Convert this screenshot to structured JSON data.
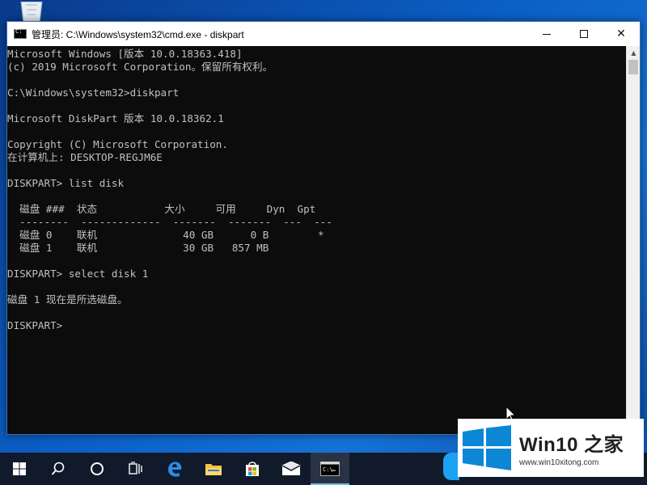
{
  "window": {
    "title": "管理员: C:\\Windows\\system32\\cmd.exe - diskpart",
    "minimize_icon": "minimize-icon",
    "maximize_icon": "maximize-icon",
    "close_label": "✕"
  },
  "console": {
    "lines": [
      "Microsoft Windows [版本 10.0.18363.418]",
      "(c) 2019 Microsoft Corporation。保留所有权利。",
      "",
      "C:\\Windows\\system32>diskpart",
      "",
      "Microsoft DiskPart 版本 10.0.18362.1",
      "",
      "Copyright (C) Microsoft Corporation.",
      "在计算机上: DESKTOP-REGJM6E",
      "",
      "DISKPART> list disk",
      "",
      "  磁盘 ###  状态           大小     可用     Dyn  Gpt",
      "  --------  -------------  -------  -------  ---  ---",
      "  磁盘 0    联机              40 GB      0 B        *",
      "  磁盘 1    联机              30 GB   857 MB",
      "",
      "DISKPART> select disk 1",
      "",
      "磁盘 1 现在是所选磁盘。",
      "",
      "DISKPART>"
    ]
  },
  "watermark": {
    "brand": "Win10 之家",
    "url": "www.win10xitong.com"
  },
  "taskbar": {
    "items": [
      {
        "name": "start-button",
        "icon": "windows-logo-icon"
      },
      {
        "name": "search-button",
        "icon": "search-icon"
      },
      {
        "name": "cortana-button",
        "icon": "cortana-icon"
      },
      {
        "name": "task-view-button",
        "icon": "task-view-icon"
      },
      {
        "name": "edge-button",
        "icon": "edge-icon"
      },
      {
        "name": "file-explorer-button",
        "icon": "folder-icon"
      },
      {
        "name": "store-button",
        "icon": "store-icon"
      },
      {
        "name": "mail-button",
        "icon": "mail-icon"
      },
      {
        "name": "cmd-button",
        "icon": "cmd-icon",
        "active": true
      }
    ]
  },
  "colors": {
    "console_bg": "#0c0c0c",
    "console_fg": "#c0c0c0",
    "taskbar_bg": "#101a2a",
    "accent": "#0078d7"
  }
}
